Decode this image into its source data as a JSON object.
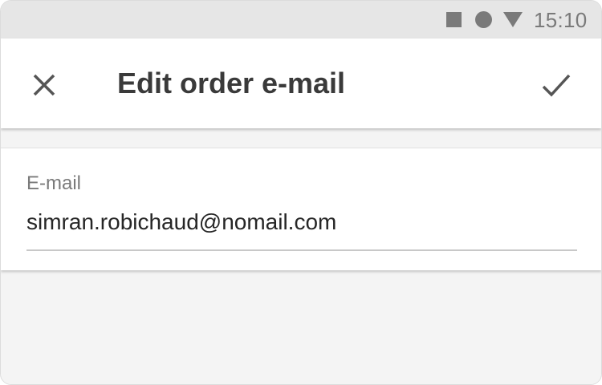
{
  "status_bar": {
    "time": "15:10",
    "icons": [
      "stop-square-icon",
      "record-circle-icon",
      "signal-triangle-icon"
    ]
  },
  "app_bar": {
    "title": "Edit order e-mail",
    "close_icon": "close-icon",
    "confirm_icon": "check-icon"
  },
  "form": {
    "email": {
      "label": "E-mail",
      "value": "simran.robichaud@nomail.com"
    }
  },
  "colors": {
    "status_bar_bg": "#e6e6e6",
    "icon_gray": "#7a7a7a",
    "title_text": "#3a3a3a",
    "surface": "#ffffff",
    "background": "#f4f4f4",
    "underline": "#c8c8c8"
  }
}
